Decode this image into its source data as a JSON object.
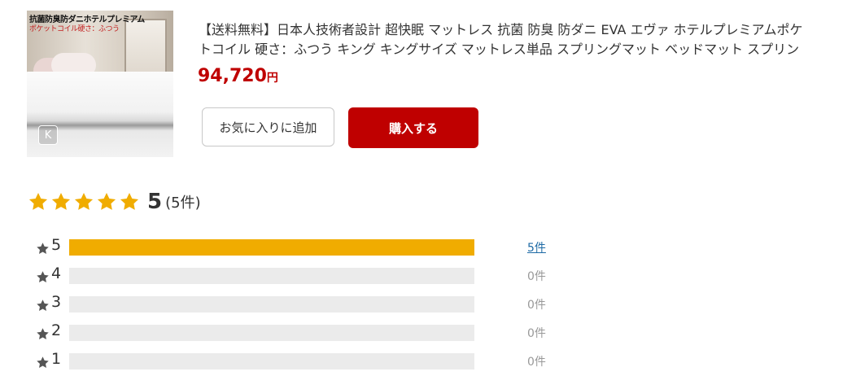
{
  "product": {
    "image_text_1": "抗菌防臭防ダニホテルプレミアム",
    "image_text_2": "ポケットコイル硬さ：ふつう",
    "image_badge": "K",
    "title_line1": "【送料無料】日本人技術者設計 超快眠 マットレス 抗菌 防臭 防ダニ EVA エヴァ ホテルプレミアムポケ",
    "title_line2": "トコイル 硬さ：ふつう キング キングサイズ マットレス単品 スプリングマット ベッドマット スプリン",
    "price": "94,720",
    "price_unit": "円",
    "fav_button": "お気に入りに追加",
    "buy_button": "購入する"
  },
  "rating": {
    "stars": 5,
    "score": "5",
    "count_text": "(5件)",
    "distribution": [
      {
        "label": "5",
        "count": "5件",
        "ratio": 1.0,
        "link": true
      },
      {
        "label": "4",
        "count": "0件",
        "ratio": 0,
        "link": false
      },
      {
        "label": "3",
        "count": "0件",
        "ratio": 0,
        "link": false
      },
      {
        "label": "2",
        "count": "0件",
        "ratio": 0,
        "link": false
      },
      {
        "label": "1",
        "count": "0件",
        "ratio": 0,
        "link": false
      }
    ]
  },
  "colors": {
    "brand_red": "#bf0000",
    "star_gold": "#f0ac00",
    "track_gray": "#ebebeb",
    "link_blue": "#1d6aa5"
  }
}
